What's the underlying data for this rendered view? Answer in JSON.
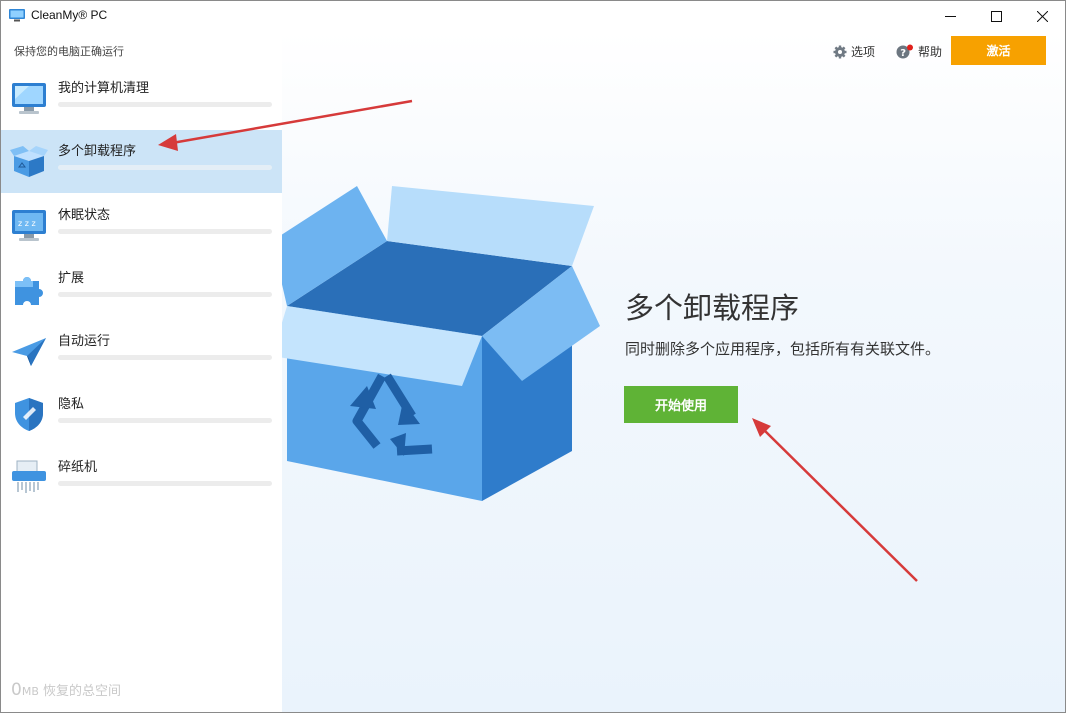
{
  "window": {
    "title": "CleanMy® PC",
    "subtitle": "保持您的电脑正确运行"
  },
  "header": {
    "options_label": "选项",
    "help_label": "帮助",
    "activate_label": "激活",
    "activate_color": "#f7a100"
  },
  "sidebar": {
    "items": [
      {
        "label": "我的计算机清理",
        "icon": "monitor-icon"
      },
      {
        "label": "多个卸载程序",
        "icon": "box-icon",
        "active": true
      },
      {
        "label": "休眠状态",
        "icon": "sleep-monitor-icon"
      },
      {
        "label": "扩展",
        "icon": "puzzle-icon"
      },
      {
        "label": "自动运行",
        "icon": "paper-plane-icon"
      },
      {
        "label": "隐私",
        "icon": "shield-icon"
      },
      {
        "label": "碎纸机",
        "icon": "shredder-icon"
      }
    ],
    "footer": {
      "value": "0",
      "unit": "MB",
      "text": "恢复的总空间"
    }
  },
  "main": {
    "title": "多个卸载程序",
    "description": "同时删除多个应用程序，包括所有有关联文件。",
    "start_label": "开始使用",
    "start_color": "#5fb336"
  }
}
